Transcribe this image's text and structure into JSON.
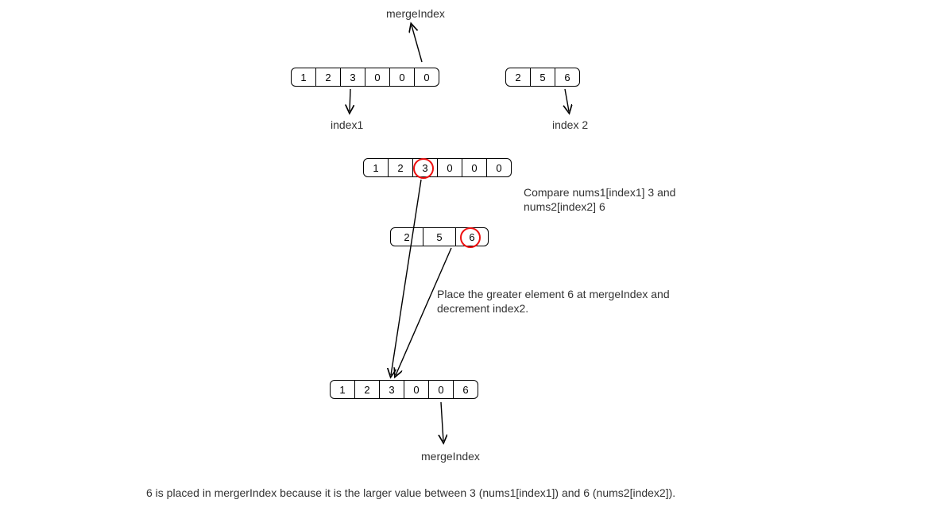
{
  "labels": {
    "mergeIndex_top": "mergeIndex",
    "index1": "index1",
    "index2": "index 2",
    "compare": "Compare nums1[index1] 3 and nums2[index2] 6",
    "place": "Place the greater element 6 at mergeIndex and decrement index2.",
    "mergeIndex_bottom": "mergeIndex",
    "caption": "6 is placed in mergerIndex because it is the larger value between 3 (nums1[index1]) and 6 (nums2[index2])."
  },
  "arrays": {
    "top_nums1": [
      "1",
      "2",
      "3",
      "0",
      "0",
      "0"
    ],
    "top_nums2": [
      "2",
      "5",
      "6"
    ],
    "mid_nums1": [
      "1",
      "2",
      "3",
      "0",
      "0",
      "0"
    ],
    "mid_nums2": [
      "2",
      "5",
      "6"
    ],
    "bottom_nums1": [
      "1",
      "2",
      "3",
      "0",
      "0",
      "6"
    ]
  },
  "highlights": {
    "mid_nums1_circle_index": 2,
    "mid_nums2_circle_index": 2
  },
  "chart_data": {
    "type": "table",
    "description": "Merge-sorted-array step illustration",
    "nums1_initial": [
      1,
      2,
      3,
      0,
      0,
      0
    ],
    "nums2_initial": [
      2,
      5,
      6
    ],
    "index1_points_to_cell": 2,
    "index2_points_to_cell": 2,
    "mergeIndex_points_to_cell": 5,
    "compared_values": {
      "nums1_index1": 3,
      "nums2_index2": 6
    },
    "action": "place greater (6) at mergeIndex, decrement index2",
    "nums1_after_step": [
      1,
      2,
      3,
      0,
      0,
      6
    ],
    "mergeIndex_after_points_to_cell": 4
  }
}
